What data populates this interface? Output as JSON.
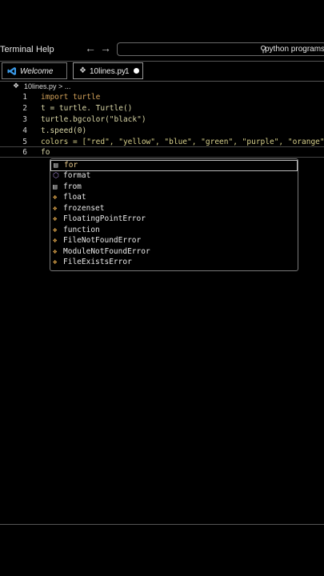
{
  "menu": {
    "terminal": "Terminal",
    "help": "Help"
  },
  "nav": {
    "back_icon": "←",
    "forward_icon": "→"
  },
  "command_center": {
    "text": "python programs"
  },
  "tabs": [
    {
      "label": "Welcome"
    },
    {
      "label": "10lines.py",
      "badge": "1"
    }
  ],
  "breadcrumb": {
    "file": "10lines.py",
    "more": "..."
  },
  "code": {
    "line_numbers": [
      "1",
      "2",
      "3",
      "4",
      "5",
      "6"
    ],
    "lines": [
      {
        "text": "import turtle"
      },
      {
        "text": "t = turtle. Turtle()"
      },
      {
        "text": "turtle.bgcolor(\"black\")"
      },
      {
        "text": "t.speed(0)"
      },
      {
        "text": "colors = [\"red\", \"yellow\", \"blue\", \"green\", \"purple\", \"orange\"]"
      },
      {
        "text": "fo"
      }
    ]
  },
  "suggestions": [
    {
      "label": "for",
      "icon": "snippet-icon",
      "selected": true
    },
    {
      "label": "format",
      "icon": "cube-icon"
    },
    {
      "label": "from",
      "icon": "keyword-icon"
    },
    {
      "label": "float",
      "icon": "class-icon"
    },
    {
      "label": "frozenset",
      "icon": "class-icon"
    },
    {
      "label": "FloatingPointError",
      "icon": "class-icon"
    },
    {
      "label": "function",
      "icon": "class-icon"
    },
    {
      "label": "FileNotFoundError",
      "icon": "class-icon"
    },
    {
      "label": "ModuleNotFoundError",
      "icon": "class-icon"
    },
    {
      "label": "FileExistsError",
      "icon": "class-icon"
    }
  ]
}
